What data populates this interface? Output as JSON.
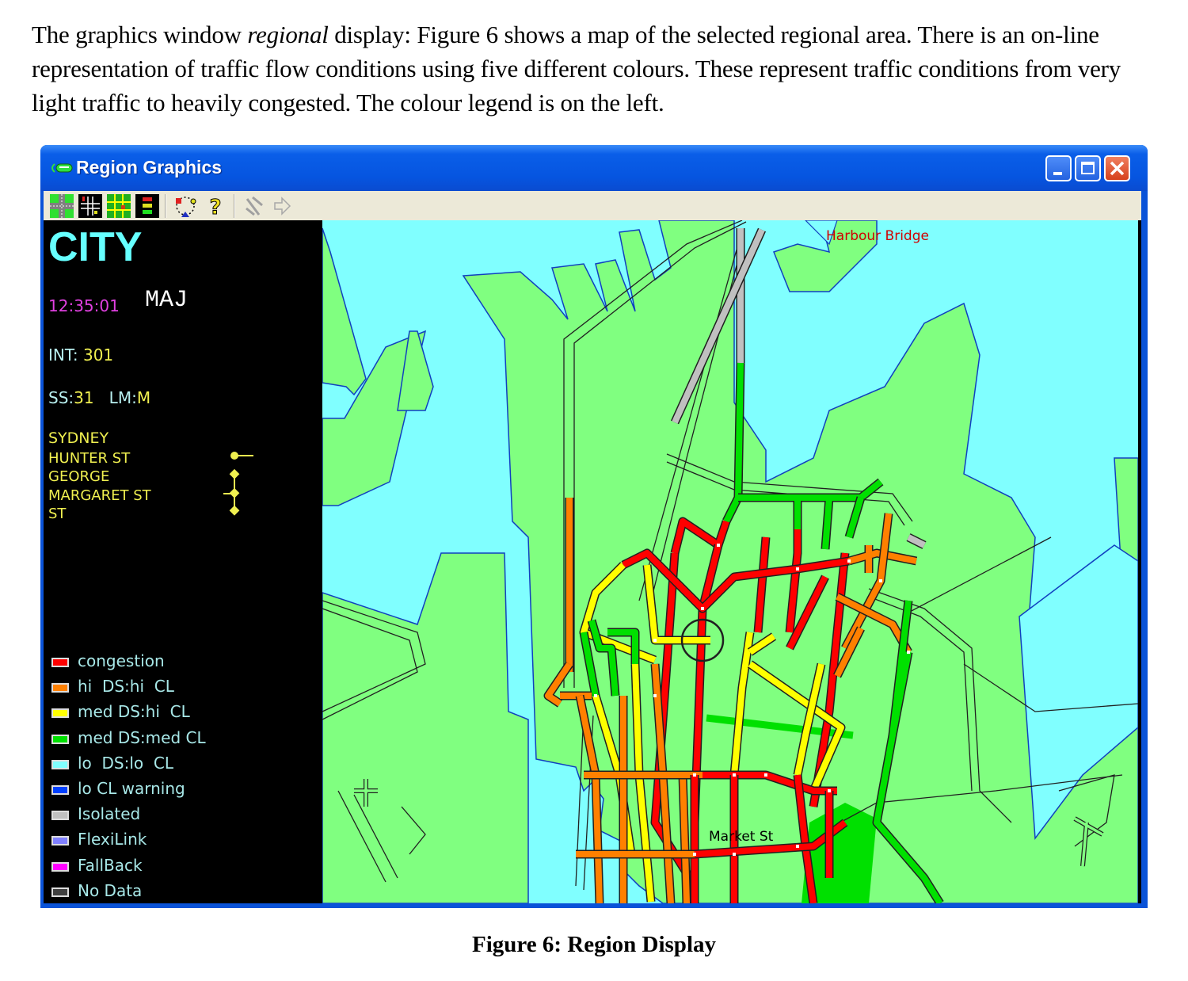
{
  "document": {
    "paragraph_prefix": "The graphics window ",
    "paragraph_italic": "regional",
    "paragraph_suffix": " display: Figure 6 shows a map of the selected regional area. There is an on-line representation of traffic flow conditions using five different colours. These represent traffic conditions from very light traffic to heavily congested. The colour legend is on the left.",
    "caption": "Figure 6: Region Display"
  },
  "window": {
    "title": "Region Graphics",
    "controls": [
      "minimize",
      "maximize",
      "close"
    ]
  },
  "toolbar": {
    "buttons": [
      {
        "icon": "intersection-view-icon"
      },
      {
        "icon": "detector-layout-icon"
      },
      {
        "icon": "grid-map-icon"
      },
      {
        "icon": "signal-phase-icon"
      },
      {
        "icon": "cycle-timer-icon"
      },
      {
        "icon": "help-icon"
      },
      {
        "icon": "tools-icon-disabled"
      },
      {
        "icon": "forward-arrow-icon-disabled"
      }
    ]
  },
  "side_panel": {
    "region": "CITY",
    "time": "12:35:01",
    "mode": "MAJ",
    "int_label": "INT:",
    "int_value": "301",
    "ss_label": "SS:",
    "ss_value": "31",
    "lm_label": "LM:",
    "lm_value": "M",
    "location_lines": [
      "SYDNEY",
      "HUNTER ST",
      "GEORGE",
      "MARGARET ST",
      "ST"
    ],
    "signal_color": "#f0f050"
  },
  "legend": [
    {
      "label": "congestion",
      "color": "#ff0000"
    },
    {
      "label": "hi  DS:hi  CL",
      "color": "#ff8000"
    },
    {
      "label": "med DS:hi  CL",
      "color": "#ffff00"
    },
    {
      "label": "med DS:med CL",
      "color": "#00e000"
    },
    {
      "label": "lo  DS:lo  CL",
      "color": "#80ffff"
    },
    {
      "label": "lo CL warning",
      "color": "#0040ff"
    },
    {
      "label": "Isolated",
      "color": "#c0c0c0"
    },
    {
      "label": "FlexiLink",
      "color": "#8080ff"
    },
    {
      "label": "FallBack",
      "color": "#ff00ff"
    },
    {
      "label": "No Data",
      "color": "#404040"
    }
  ],
  "map": {
    "labels": [
      {
        "text": "Harbour Bridge",
        "color": "#d00000"
      },
      {
        "text": "Market St",
        "color": "#000000"
      }
    ],
    "colors": {
      "water": "#80ffff",
      "land": "#80ff80",
      "park": "#00e000",
      "congestion": "#ff0000",
      "hi": "#ff8000",
      "med": "#ffff00",
      "ok": "#00e000",
      "isolated": "#c0c0c0"
    },
    "selected_intersection": "301"
  }
}
